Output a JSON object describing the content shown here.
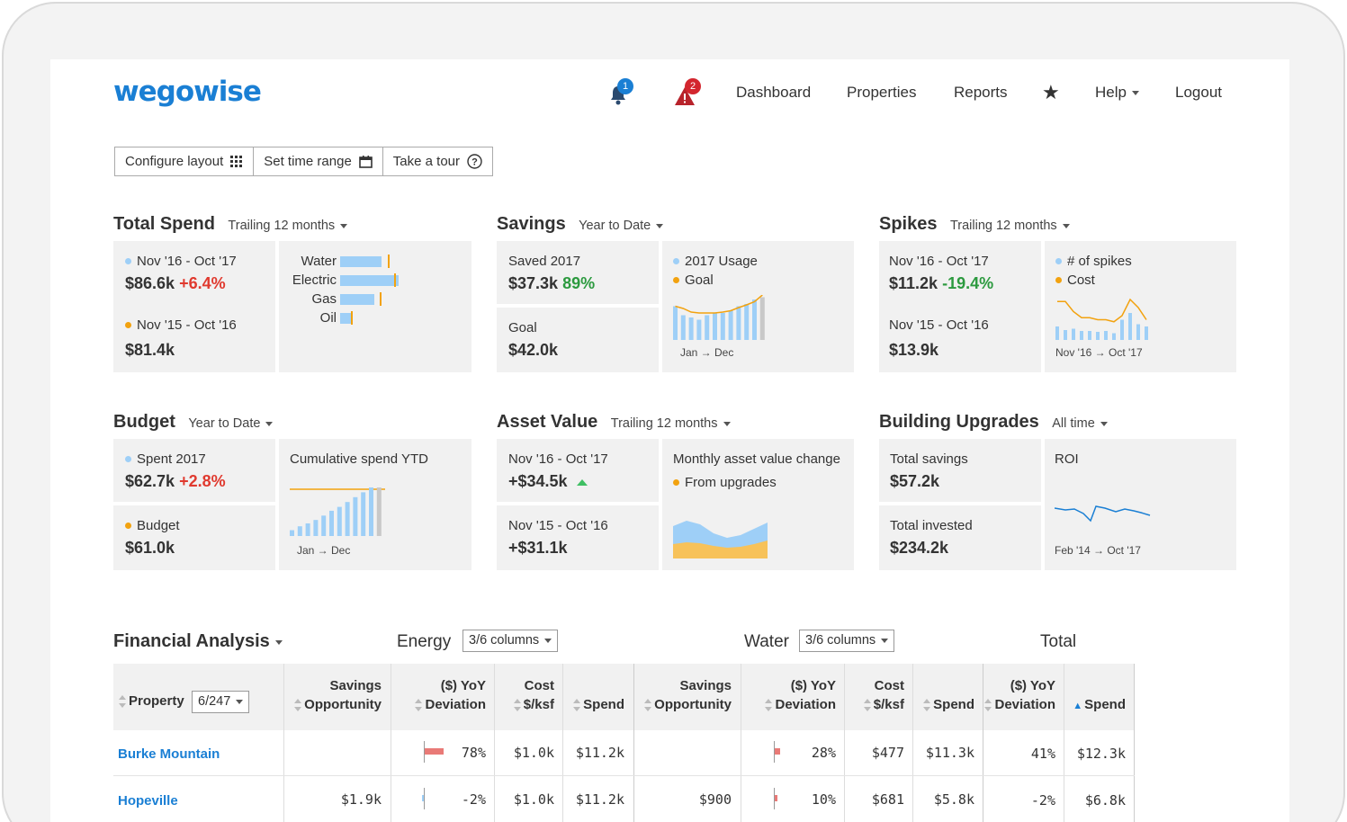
{
  "header": {
    "logo": "wegowise",
    "notifications_count": "1",
    "alerts_count": "2",
    "nav": [
      "Dashboard",
      "Properties",
      "Reports"
    ],
    "help": "Help",
    "logout": "Logout"
  },
  "toolbar": {
    "configure": "Configure layout",
    "time_range": "Set time range",
    "tour": "Take a tour"
  },
  "colors": {
    "accent": "#1a7fd4",
    "bar_blue": "#9ecff7",
    "orange": "#f2a20f",
    "red": "#e03a2f",
    "green": "#2c9a3f",
    "panel": "#f1f1f1"
  },
  "total_spend": {
    "title": "Total Spend",
    "range": "Trailing 12 months",
    "current_label": "Nov '16 - Oct '17",
    "current_value": "$86.6k",
    "current_change": "+6.4%",
    "prev_label": "Nov '15 - Oct '16",
    "prev_value": "$81.4k",
    "breakdown": [
      {
        "name": "Water",
        "current": 0.7,
        "previous": 0.82
      },
      {
        "name": "Electric",
        "current": 1.0,
        "previous": 0.92
      },
      {
        "name": "Gas",
        "current": 0.58,
        "previous": 0.68
      },
      {
        "name": "Oil",
        "current": 0.2,
        "previous": 0.18
      }
    ]
  },
  "savings": {
    "title": "Savings",
    "range": "Year to Date",
    "saved_label": "Saved 2017",
    "saved_value": "$37.3k",
    "saved_pct": "89%",
    "goal_label": "Goal",
    "goal_value": "$42.0k",
    "legend_usage": "2017 Usage",
    "legend_goal": "Goal",
    "axis": "Jan → Dec",
    "usage": [
      0.75,
      0.55,
      0.5,
      0.45,
      0.55,
      0.6,
      0.6,
      0.65,
      0.75,
      0.8,
      0.9,
      0.95
    ],
    "goal": [
      0.75,
      0.7,
      0.62,
      0.6,
      0.6,
      0.6,
      0.62,
      0.65,
      0.72,
      0.78,
      0.85,
      1.0
    ]
  },
  "spikes": {
    "title": "Spikes",
    "range": "Trailing 12 months",
    "current_label": "Nov '16 - Oct '17",
    "current_value": "$11.2k",
    "current_change": "-19.4%",
    "prev_label": "Nov '15 - Oct '16",
    "prev_value": "$13.9k",
    "legend_spikes": "# of spikes",
    "legend_cost": "Cost",
    "axis": "Nov '16 → Oct '17",
    "counts": [
      0.3,
      0.22,
      0.25,
      0.2,
      0.2,
      0.18,
      0.2,
      0.15,
      0.45,
      0.6,
      0.35,
      0.3
    ],
    "cost": [
      0.95,
      0.95,
      0.7,
      0.55,
      0.55,
      0.5,
      0.5,
      0.45,
      0.6,
      1.0,
      0.8,
      0.5
    ]
  },
  "budget": {
    "title": "Budget",
    "range": "Year to Date",
    "spent_label": "Spent 2017",
    "spent_value": "$62.7k",
    "spent_change": "+2.8%",
    "budget_label": "Budget",
    "budget_value": "$61.0k",
    "chart_label": "Cumulative spend YTD",
    "axis": "Jan → Dec",
    "bars": [
      0.12,
      0.2,
      0.26,
      0.33,
      0.42,
      0.52,
      0.6,
      0.7,
      0.8,
      0.9,
      1.0,
      1.0
    ]
  },
  "asset_value": {
    "title": "Asset Value",
    "range": "Trailing 12 months",
    "current_label": "Nov '16 - Oct '17",
    "current_value": "+$34.5k",
    "prev_label": "Nov '15 - Oct '16",
    "prev_value": "+$31.1k",
    "chart_label": "Monthly asset value change",
    "legend": "From upgrades"
  },
  "upgrades": {
    "title": "Building Upgrades",
    "range": "All time",
    "savings_label": "Total savings",
    "savings_value": "$57.2k",
    "invested_label": "Total invested",
    "invested_value": "$234.2k",
    "roi_label": "ROI",
    "axis": "Feb '14 → Oct '17"
  },
  "financial": {
    "title": "Financial Analysis",
    "energy_label": "Energy",
    "energy_cols": "3/6 columns",
    "water_label": "Water",
    "water_cols": "3/6 columns",
    "total_label": "Total",
    "property_header": "Property",
    "property_count": "6/247",
    "headers": {
      "e_savings": [
        "Savings",
        "Opportunity"
      ],
      "e_yoy": [
        "($) YoY",
        "Deviation"
      ],
      "e_cost": [
        "Cost",
        "$/ksf"
      ],
      "e_spend": "Spend",
      "w_savings": [
        "Savings",
        "Opportunity"
      ],
      "w_yoy": [
        "($) YoY",
        "Deviation"
      ],
      "w_cost": [
        "Cost",
        "$/ksf"
      ],
      "w_spend": "Spend",
      "t_yoy": [
        "($) YoY",
        "Deviation"
      ],
      "t_spend": "Spend"
    },
    "rows": [
      {
        "name": "Burke Mountain",
        "e_savings": "",
        "e_yoy": "78%",
        "e_cost": "$1.0k",
        "e_spend": "$11.2k",
        "w_savings": "",
        "w_yoy": "28%",
        "w_cost": "$477",
        "w_spend": "$11.3k",
        "t_yoy": "41%",
        "t_spend": "$12.3k"
      },
      {
        "name": "Hopeville",
        "e_savings": "$1.9k",
        "e_yoy": "-2%",
        "e_cost": "$1.0k",
        "e_spend": "$11.2k",
        "w_savings": "$900",
        "w_yoy": "10%",
        "w_cost": "$681",
        "w_spend": "$5.8k",
        "t_yoy": "-2%",
        "t_spend": "$6.8k"
      }
    ]
  }
}
